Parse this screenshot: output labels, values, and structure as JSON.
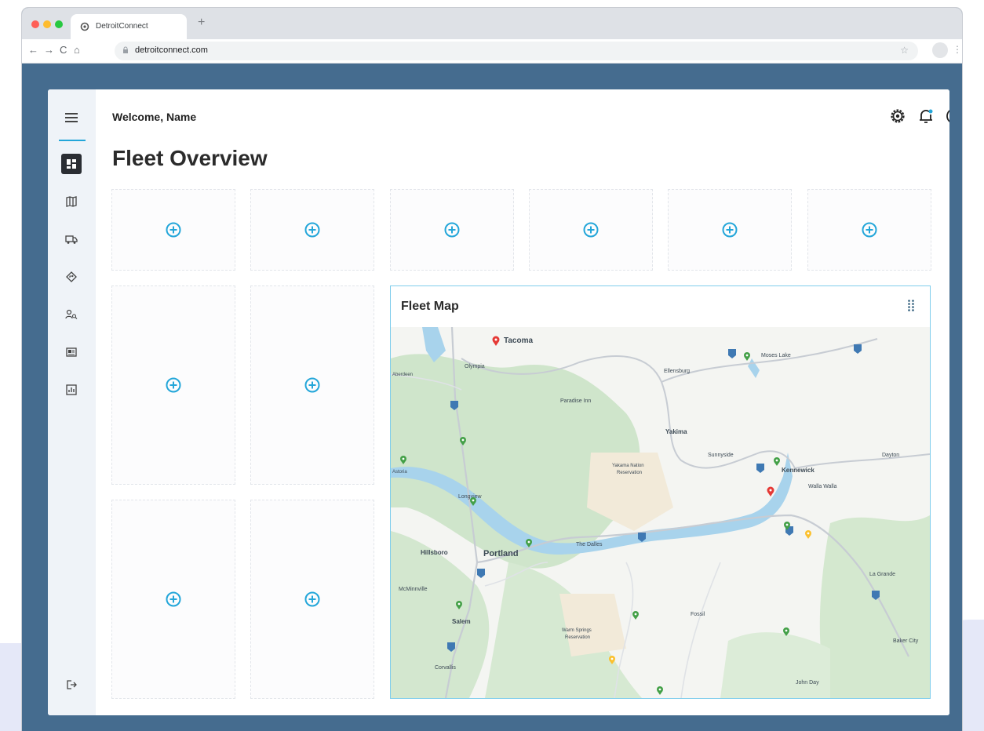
{
  "browser": {
    "tab_title": "DetroitConnect",
    "new_tab_symbol": "+",
    "url": "detroitconnect.com",
    "nav_back": "←",
    "nav_forward": "→",
    "nav_reload": "C",
    "nav_home": "⌂",
    "star_symbol": "☆",
    "menu_symbol": "⋮",
    "traffic_lights": [
      "#fe5f57",
      "#febc2e",
      "#28c840"
    ]
  },
  "app": {
    "welcome": "Welcome, Name",
    "page_title": "Fleet Overview",
    "accent_color": "#23a6d9",
    "sidebar": {
      "items": [
        {
          "icon": "dashboard-icon",
          "active": true
        },
        {
          "icon": "map-icon",
          "active": false
        },
        {
          "icon": "truck-icon",
          "active": false
        },
        {
          "icon": "route-icon",
          "active": false
        },
        {
          "icon": "driver-search-icon",
          "active": false
        },
        {
          "icon": "id-card-icon",
          "active": false
        },
        {
          "icon": "report-icon",
          "active": false
        }
      ],
      "logout_icon": "logout-icon"
    },
    "header_icons": [
      "settings-icon",
      "notification-bell-icon",
      "account-icon"
    ],
    "widget_slot_icon": "add-circle-icon",
    "fleet_map": {
      "title": "Fleet Map",
      "drag_icon": "drag-handle-icon",
      "labels": {
        "tacoma": "Tacoma",
        "olympia": "Olympia",
        "moses_lake": "Moses Lake",
        "ellensburg": "Ellensburg",
        "paradise_inn": "Paradise Inn",
        "yakima": "Yakima",
        "sunnyside": "Sunnyside",
        "kennewick": "Kennewick",
        "walla_walla": "Walla Walla",
        "dayton": "Dayton",
        "yakama": "Yakama Nation",
        "reservation": "Reservation",
        "longview": "Longview",
        "the_dalles": "The Dalles",
        "hillsboro": "Hillsboro",
        "portland": "Portland",
        "mcminnville": "McMinnville",
        "salem": "Salem",
        "corvallis": "Corvallis",
        "warm_springs": "Warm Springs",
        "fossil": "Fossil",
        "la_grande": "La Grande",
        "baker_city": "Baker City",
        "john_day": "John Day",
        "aberdeen": "Aberdeen",
        "astoria": "Astoria"
      }
    }
  }
}
